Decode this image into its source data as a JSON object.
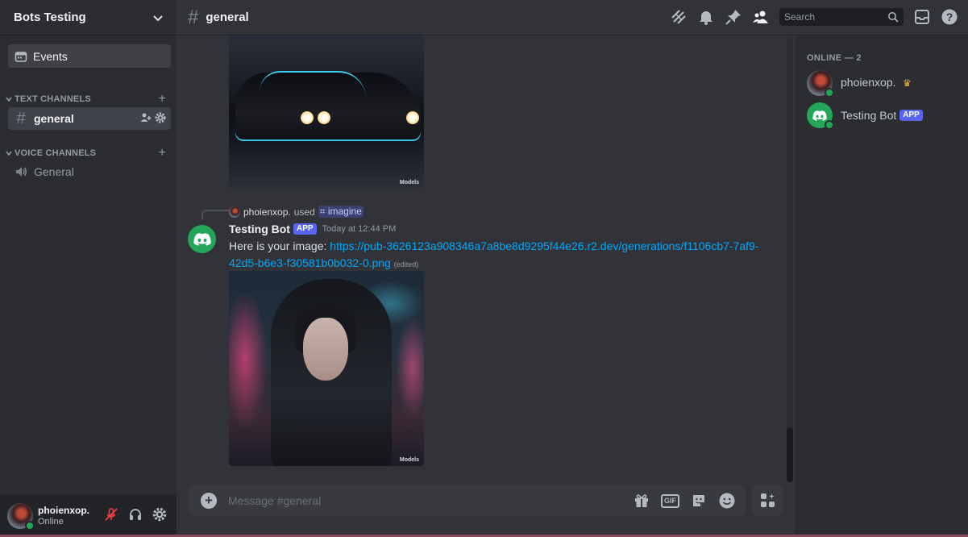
{
  "server": {
    "name": "Bots Testing"
  },
  "sidebar": {
    "events_label": "Events",
    "categories": [
      {
        "label": "TEXT CHANNELS",
        "add": "+"
      },
      {
        "label": "VOICE CHANNELS",
        "add": "+"
      }
    ],
    "text_channels": [
      {
        "label": "general",
        "active": true
      }
    ],
    "voice_channels": [
      {
        "label": "General"
      }
    ]
  },
  "user_panel": {
    "username": "phoienxop.",
    "status": "Online"
  },
  "topbar": {
    "channel_name": "general",
    "search_placeholder": "Search",
    "icons": [
      "threads-icon",
      "bell-icon",
      "pin-icon",
      "members-icon",
      "inbox-icon",
      "help-icon"
    ]
  },
  "chat": {
    "images": [
      {
        "watermark": "Models"
      },
      {
        "watermark": "Models"
      }
    ],
    "reply": {
      "user": "phoienxop.",
      "used_text": "used",
      "command": "imagine"
    },
    "message": {
      "author": "Testing Bot",
      "tag": "APP",
      "timestamp": "Today at 12:44 PM",
      "text": "Here is your image:",
      "link": "https://pub-3626123a908346a7a8be8d9295f44e26.r2.dev/generations/f1106cb7-7af9-42d5-b6e3-f30581b0b032-0.png",
      "edited": "(edited)"
    }
  },
  "composer": {
    "placeholder": "Message #general",
    "gif_label": "GIF"
  },
  "members": {
    "header": "ONLINE — 2",
    "list": [
      {
        "name": "phoienxop.",
        "owner": true
      },
      {
        "name": "Testing Bot",
        "tag": "APP"
      }
    ]
  },
  "colors": {
    "accent": "#5865f2",
    "online": "#23a55a",
    "link": "#00a8fc",
    "background": "#313338",
    "sidebar": "#2b2d31"
  }
}
